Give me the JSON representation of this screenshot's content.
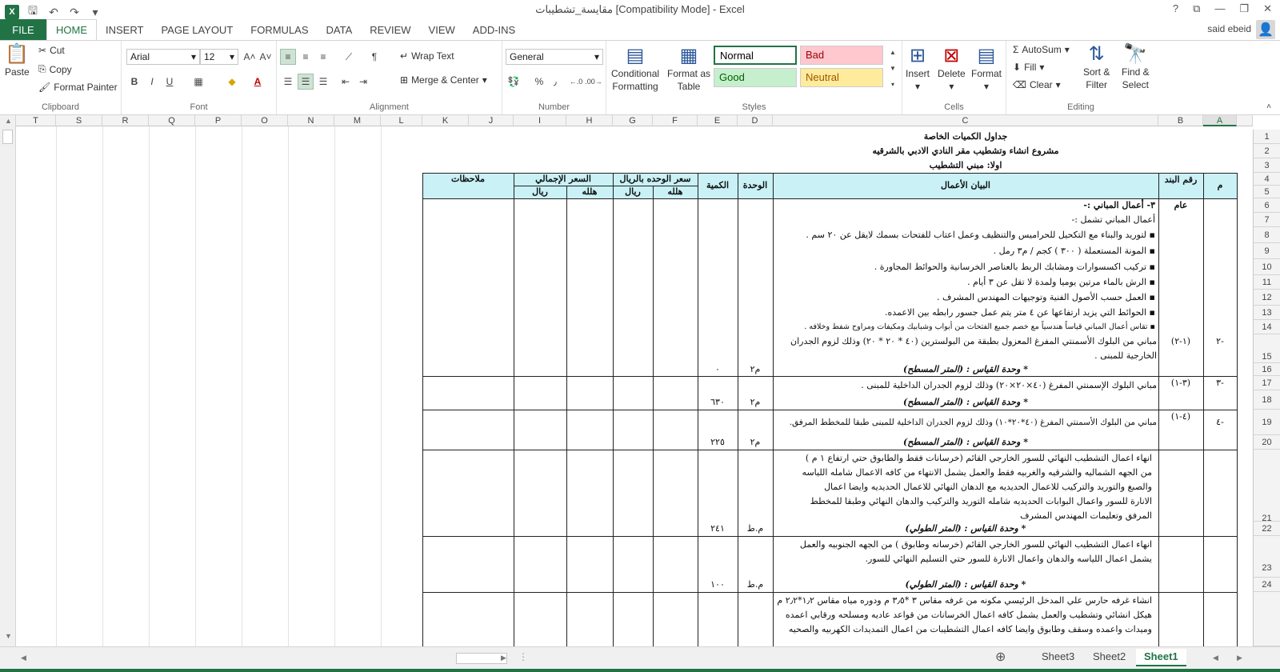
{
  "window": {
    "title": "مقايسة_تشطيبات  [Compatibility Mode] - Excel",
    "help": "?",
    "controls": [
      "⧉",
      "—",
      "❐",
      "✕"
    ]
  },
  "ribbon_tabs": {
    "file": "FILE",
    "tabs": [
      "HOME",
      "INSERT",
      "PAGE LAYOUT",
      "FORMULAS",
      "DATA",
      "REVIEW",
      "VIEW",
      "ADD-INS"
    ],
    "user": "said ebeid"
  },
  "clipboard": {
    "paste": "Paste",
    "cut": "Cut",
    "copy": "Copy",
    "format_painter": "Format Painter",
    "label": "Clipboard"
  },
  "font": {
    "name": "Arial",
    "size": "12",
    "label": "Font",
    "bold": "B",
    "italic": "I",
    "underline": "U",
    "grow": "A˄",
    "shrink": "A˅",
    "font_color": "A"
  },
  "alignment": {
    "wrap_text": "Wrap Text",
    "merge_center": "Merge & Center",
    "label": "Alignment"
  },
  "number": {
    "format": "General",
    "percent": "%",
    "comma": "٫",
    "inc_decimal": "←.0",
    "dec_decimal": ".00→",
    "label": "Number"
  },
  "styles": {
    "conditional": [
      "Conditional",
      "Formatting"
    ],
    "format_table": [
      "Format as",
      "Table"
    ],
    "normal": "Normal",
    "bad": "Bad",
    "good": "Good",
    "neutral": "Neutral",
    "label": "Styles",
    "colors": {
      "normal_bg": "#ffffff",
      "bad_bg": "#ffc7ce",
      "good_bg": "#c6efce",
      "neutral_bg": "#ffeb9c",
      "normal_border": "#217346"
    }
  },
  "cells": {
    "insert": "Insert",
    "delete": "Delete",
    "format": "Format",
    "label": "Cells"
  },
  "editing": {
    "autosum": "AutoSum",
    "fill": "Fill",
    "clear": "Clear",
    "sort": [
      "Sort &",
      "Filter"
    ],
    "find": [
      "Find &",
      "Select"
    ],
    "label": "Editing"
  },
  "columns": [
    "T",
    "S",
    "R",
    "Q",
    "P",
    "O",
    "N",
    "M",
    "L",
    "K",
    "J",
    "I",
    "H",
    "G",
    "F",
    "E",
    "D",
    "C",
    "B",
    "A"
  ],
  "rows": [
    "1",
    "2",
    "3",
    "4",
    "5",
    "6",
    "7",
    "8",
    "9",
    "10",
    "11",
    "12",
    "13",
    "14",
    "15",
    "16",
    "17",
    "18",
    "19",
    "20",
    "21",
    "22",
    "23",
    "24"
  ],
  "sheet": {
    "title1": "جداول الكميات الخاصة",
    "title2": "مشروع انشاء وتشطيب مقر النادي الادبي بالشرقيه",
    "title3": "اولا: مبني التشطيب",
    "headers": {
      "m": "م",
      "item_no": "رقم البند",
      "desc": "البيان الأعمال",
      "unit": "الوحدة",
      "qty": "الكمية",
      "unit_price": "سعر الوحده بالريال",
      "total_price": "السعر الإجمالي",
      "halala": "هلله",
      "riyal": "ريال",
      "notes": "ملاحظات"
    },
    "r6_b": "عام",
    "r6_c": "٣- أعمال المباني :-",
    "r7_c": "أعمال المباني تشمل :-",
    "bullets": [
      "لتوريد والبناء مع التكحيل للحراميس والتنظيف وعمل اعتاب للفتحات بسمك لايقل عن ٢٠ سم .",
      "المونة المستعملة ( ٣٠٠ ) كجم / م٣ رمل .",
      "تركيب اكسسوارات ومشابك الربط بالعناصر الخرسانية والحوائط المجاورة .",
      "الرش بالماء مرتين يوميا ولمدة لا تقل عن ٣ أيام .",
      "العمل حسب الأصول الفنية وتوجيهات المهندس المشرف .",
      "الحوائط التي يزيد ارتفاعها عن ٤ متر يتم عمل جسور رابطه بين الاعمده.",
      "تقاس أعمال المباني قياساً هندسياً مع خصم جميع الفتحات من أبواب وشبابيك ومكيفات ومراوح شفط وخلافه ."
    ],
    "r15": {
      "a": "-٢",
      "b": "(١-٢)",
      "c": "مباني من البلوك الأسمنتي المفرغ المعزول بطبقة من البولسترين (٤٠ * ٢٠ * ٢٠) وذلك لزوم الجدران الخارجية للمبنى ."
    },
    "r16": {
      "c": "* وحدة القياس : (المتر المسطح)",
      "d": "م٢",
      "e": "٠"
    },
    "r17": {
      "a": "-٣",
      "b": "(٣-١)",
      "c": "مباني البلوك الإسمنتي المفرغ (٤٠×٢٠×٢٠) وذلك لزوم الجدران الداخلية للمبنى ."
    },
    "r18": {
      "c": "* وحدة القياس : (المتر المسطح)",
      "d": "م٢",
      "e": "٦٣٠"
    },
    "r19": {
      "a": "-٤",
      "b": "(٤-١)",
      "c": "مباني من البلوك الأسمنتي المفرغ (٤٠*٢٠*١٠) وذلك لزوم الجدران الداخلية للمبنى طبقا للمخطط المرفق."
    },
    "r20": {
      "c": "* وحدة القياس : (المتر المسطح)",
      "d": "م٢",
      "e": "٢٢٥"
    },
    "r21": {
      "c": "انهاء اعمال التشطيب النهائي للسور الخارجي القائم (خرسانات فقط والطابوق حتي ارتفاع ١ م ) من الجهه الشماليه والشرقيه والغربيه فقط والعمل يشمل الانتهاء من كافه الاعمال شامله اللياسه والصبغ والتوريد والتركيب للاعمال الحديديه مع الدهان النهائي للاعمال الحديديه وايضا اعمال الانارة للسور واعمال البوابات الحديديه شامله التوريد والتركيب والدهان النهائي وطبقا للمخطط المرفق وتعليمات المهندس المشرف"
    },
    "r22": {
      "c": "* وحدة القياس : (المتر الطولي)",
      "d": "م.ط",
      "e": "٢٤١"
    },
    "r23": {
      "c": "انهاء اعمال التشطيب النهائي للسور الخارجي القائم (خرسانه وطابوق ) من الجهه الجنوبيه والعمل يشمل اعمال اللياسه والدهان واعمال الانارة للسور حتي التسليم النهائي للسور."
    },
    "r24": {
      "c": "* وحدة القياس : (المتر الطولي)",
      "d": "م.ط",
      "e": "١٠٠"
    },
    "r25": {
      "c": "انشاء غرفه حارس علي المدخل الرئيسي مكونه من غرفه مقاس ٣ *٣٫٥ م ودوره مياه مقاس ١٫٢*٢٫٢ م هيكل انشائي وتشطيب والعمل يشمل كافه اعمال الخرسانات من قواعد عاديه ومسلحه ورقابي اعمده وميدات واعمده وسقف وطابوق وايضا كافه اعمال التشطيبات من اعمال التمديدات الكهربيه والصحيه"
    }
  },
  "sheets": [
    "Sheet3",
    "Sheet2",
    "Sheet1"
  ],
  "active_sheet": "Sheet1"
}
